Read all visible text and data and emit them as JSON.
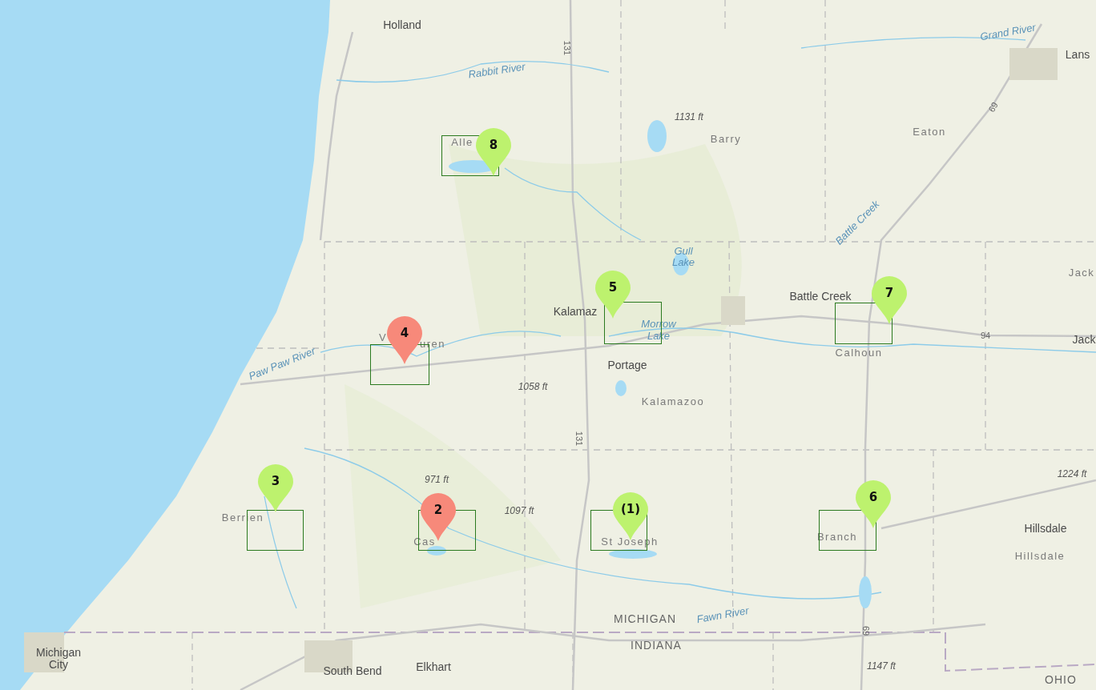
{
  "map": {
    "labels": [
      {
        "text": "Holland",
        "kind": "city"
      },
      {
        "text": "Rabbit River",
        "kind": "water"
      },
      {
        "text": "Grand River",
        "kind": "water"
      },
      {
        "text": "Lans",
        "kind": "city"
      },
      {
        "text": "131",
        "kind": "highway"
      },
      {
        "text": "1131 ft",
        "kind": "elevation"
      },
      {
        "text": "Barry",
        "kind": "county"
      },
      {
        "text": "Eaton",
        "kind": "county"
      },
      {
        "text": "69",
        "kind": "highway"
      },
      {
        "text": "Alle",
        "kind": "county"
      },
      {
        "text": "Battle Creek",
        "kind": "water"
      },
      {
        "text": "Gull",
        "kind": "water"
      },
      {
        "text": "Lake",
        "kind": "water"
      },
      {
        "text": "Jack",
        "kind": "county"
      },
      {
        "text": "Battle Creek",
        "kind": "city"
      },
      {
        "text": "Kalamaz",
        "kind": "city"
      },
      {
        "text": "Morrow",
        "kind": "water"
      },
      {
        "text": "V",
        "kind": "county"
      },
      {
        "text": "uren",
        "kind": "county"
      },
      {
        "text": "Lake",
        "kind": "water"
      },
      {
        "text": "94",
        "kind": "highway"
      },
      {
        "text": "Jack",
        "kind": "city"
      },
      {
        "text": "Calhoun",
        "kind": "county"
      },
      {
        "text": "Paw Paw River",
        "kind": "water"
      },
      {
        "text": "Portage",
        "kind": "city"
      },
      {
        "text": "1058 ft",
        "kind": "elevation"
      },
      {
        "text": "Kalamazoo",
        "kind": "county"
      },
      {
        "text": "131",
        "kind": "highway"
      },
      {
        "text": "971 ft",
        "kind": "elevation"
      },
      {
        "text": "1097 ft",
        "kind": "elevation"
      },
      {
        "text": "1224 ft",
        "kind": "elevation"
      },
      {
        "text": "Berrien",
        "kind": "county"
      },
      {
        "text": "Cas",
        "kind": "county"
      },
      {
        "text": "St Joseph",
        "kind": "county"
      },
      {
        "text": "Branch",
        "kind": "county"
      },
      {
        "text": "Hillsdale",
        "kind": "city"
      },
      {
        "text": "Hillsdale",
        "kind": "county"
      },
      {
        "text": "69",
        "kind": "highway"
      },
      {
        "text": "MICHIGAN",
        "kind": "state"
      },
      {
        "text": "Fawn River",
        "kind": "water"
      },
      {
        "text": "INDIANA",
        "kind": "state"
      },
      {
        "text": "Michigan",
        "kind": "city"
      },
      {
        "text": "City",
        "kind": "city"
      },
      {
        "text": "South Bend",
        "kind": "city"
      },
      {
        "text": "Elkhart",
        "kind": "city"
      },
      {
        "text": "1147 ft",
        "kind": "elevation"
      },
      {
        "text": "OHIO",
        "kind": "state"
      }
    ],
    "pins": [
      {
        "label": "8",
        "color": "#bdf26e"
      },
      {
        "label": "5",
        "color": "#bdf26e"
      },
      {
        "label": "7",
        "color": "#bdf26e"
      },
      {
        "label": "4",
        "color": "#f7897a"
      },
      {
        "label": "3",
        "color": "#bdf26e"
      },
      {
        "label": "2",
        "color": "#f7897a"
      },
      {
        "label": "(1)",
        "color": "#bdf26e"
      },
      {
        "label": "6",
        "color": "#bdf26e"
      }
    ]
  }
}
